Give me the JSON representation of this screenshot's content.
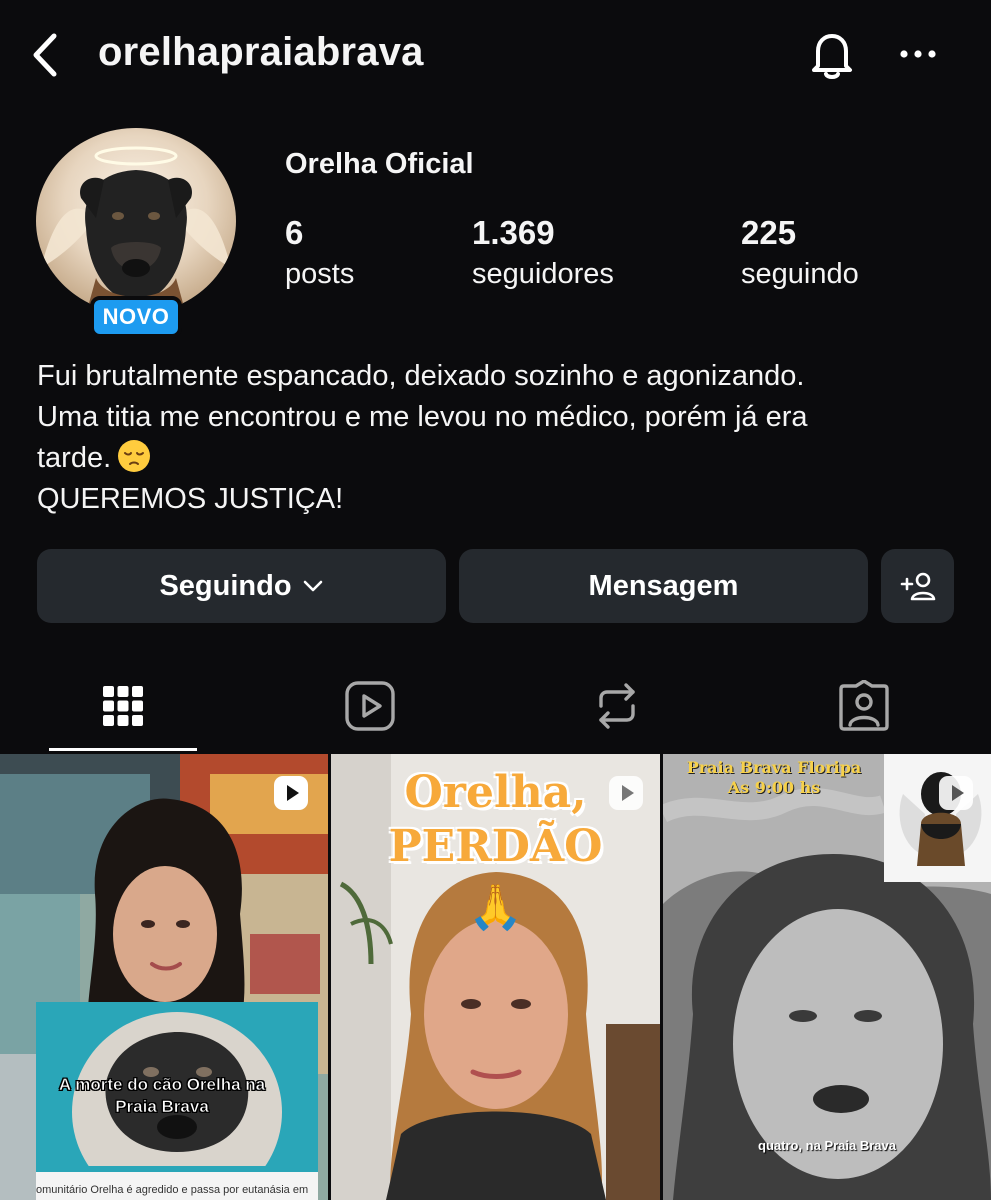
{
  "header": {
    "username": "orelhapraiabrava"
  },
  "profile": {
    "badge": "NOVO",
    "display_name": "Orelha Oficial",
    "stats": [
      {
        "value": "6",
        "label": "posts"
      },
      {
        "value": "1.369",
        "label": "seguidores"
      },
      {
        "value": "225",
        "label": "seguindo"
      }
    ],
    "bio": [
      "Fui brutalmente espancado, deixado sozinho e agonizando.",
      "Uma titia me encontrou e me levou no médico, porém já era",
      "tarde.",
      "QUEREMOS JUSTIÇA!"
    ]
  },
  "actions": {
    "following_label": "Seguindo",
    "message_label": "Mensagem"
  },
  "tabs": [
    {
      "icon": "grid-icon",
      "selected": true
    },
    {
      "icon": "reels-icon",
      "selected": false
    },
    {
      "icon": "reposts-icon",
      "selected": false
    },
    {
      "icon": "tagged-icon",
      "selected": false
    }
  ],
  "posts": [
    {
      "type": "reel",
      "caption_overlay": "A morte do cão Orelha na Praia Brava",
      "strip_text": "omunitário Orelha é agredido e passa por eutanásia em"
    },
    {
      "type": "reel",
      "title_line1": "Orelha,",
      "title_line2": "PERDÃO",
      "emoji": "🙏"
    },
    {
      "type": "reel",
      "top_line1": "Praia Brava Floripa",
      "top_line2": "As 9:00 hs",
      "subtitle": "quatro, na Praia Brava"
    }
  ],
  "colors": {
    "background": "#0b0b0d",
    "button": "#25292e",
    "badge": "#1d9bf0",
    "title_orange": "#f7a93a",
    "title_yellow": "#f7d14a"
  }
}
